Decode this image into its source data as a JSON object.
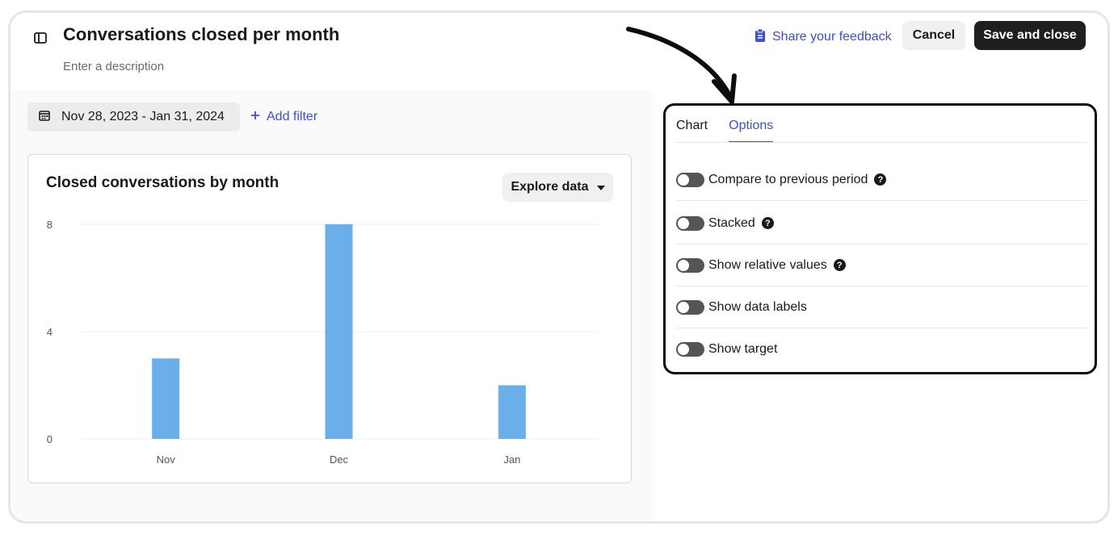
{
  "header": {
    "title": "Conversations closed per month",
    "description_placeholder": "Enter a description",
    "feedback_label": "Share your feedback",
    "cancel_label": "Cancel",
    "save_label": "Save and close"
  },
  "filters": {
    "date_range": "Nov 28, 2023 - Jan 31, 2024",
    "add_filter_label": "Add filter"
  },
  "chart_card": {
    "title": "Closed conversations by month",
    "explore_label": "Explore data"
  },
  "chart_data": {
    "type": "bar",
    "title": "Closed conversations by month",
    "categories": [
      "Nov",
      "Dec",
      "Jan"
    ],
    "values": [
      3,
      8,
      2
    ],
    "yticks": [
      0,
      4,
      8
    ],
    "ylim": [
      0,
      8
    ],
    "grid": true,
    "colors": {
      "bar": "#6aaeea",
      "grid": "#ececec"
    }
  },
  "options_panel": {
    "tabs": [
      {
        "label": "Chart",
        "active": false
      },
      {
        "label": "Options",
        "active": true
      }
    ],
    "options": [
      {
        "label": "Compare to previous period",
        "enabled": false,
        "has_help": true
      },
      {
        "label": "Stacked",
        "enabled": false,
        "has_help": true
      },
      {
        "label": "Show relative values",
        "enabled": false,
        "has_help": true
      },
      {
        "label": "Show data labels",
        "enabled": false,
        "has_help": false
      },
      {
        "label": "Show target",
        "enabled": false,
        "has_help": false
      }
    ]
  },
  "colors": {
    "accent": "#3b4fd8",
    "primary_button": "#1f1f1f"
  }
}
